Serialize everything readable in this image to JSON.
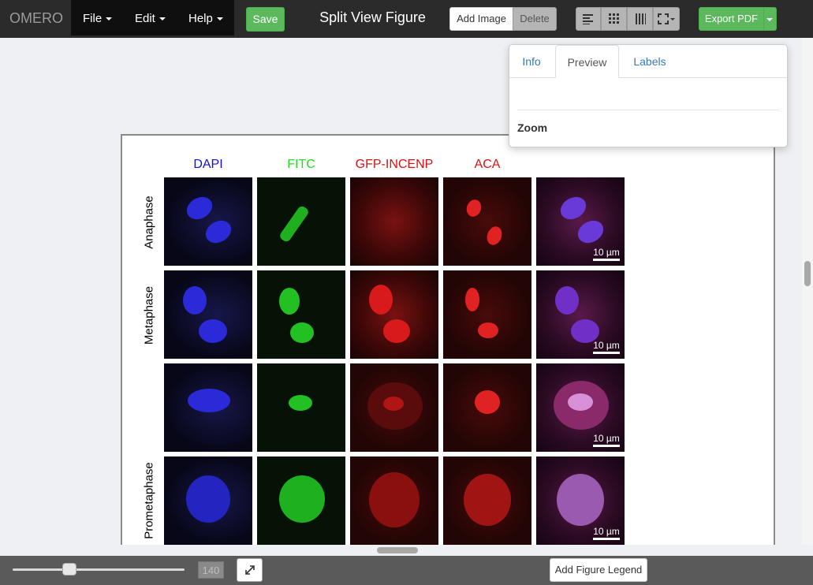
{
  "app": {
    "brand": "OMERO",
    "figure_title": "Split View Figure"
  },
  "menus": {
    "file": "File",
    "edit": "Edit",
    "help": "Help"
  },
  "toolbar": {
    "save_label": "Save",
    "add_image_label": "Add Image",
    "delete_label": "Delete",
    "layout_icons": [
      "align-left-icon",
      "grid-icon",
      "columns-icon",
      "fullscreen-icon"
    ],
    "export_label": "Export PDF"
  },
  "popover": {
    "tabs": [
      "Info",
      "Preview",
      "Labels"
    ],
    "active_tab": "Preview",
    "zoom_label": "Zoom"
  },
  "figure": {
    "channels": [
      {
        "name": "DAPI",
        "color": "#1010e0"
      },
      {
        "name": "FITC",
        "color": "#22dd22"
      },
      {
        "name": "GFP-INCENP",
        "color": "#dd1111"
      },
      {
        "name": "ACA",
        "color": "#dd1111"
      }
    ],
    "rows": [
      {
        "label": "Anaphase",
        "scalebar": "10 µm"
      },
      {
        "label": "Metaphase",
        "scalebar": "10 µm"
      },
      {
        "label": "",
        "scalebar": "10 µm"
      },
      {
        "label": "Prometaphase",
        "scalebar": "10 µm"
      }
    ]
  },
  "footer": {
    "zoom_value": "140",
    "zoom_fraction": 0.33,
    "legend_button": "Add Figure Legend"
  }
}
